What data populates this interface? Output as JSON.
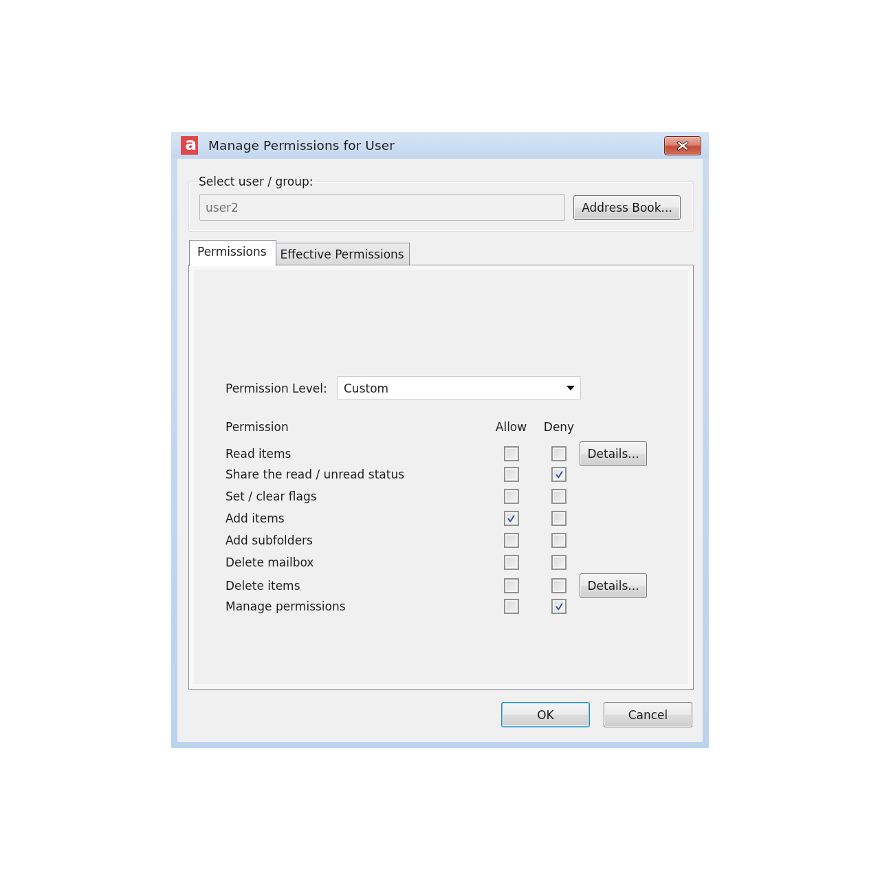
{
  "window": {
    "logo_text": "a",
    "title": "Manage Permissions for User"
  },
  "user_group": {
    "legend": "Select user / group:",
    "value": "user2",
    "disabled": true,
    "button": "Address Book..."
  },
  "tabs": [
    {
      "label": "Permissions",
      "selected": true
    },
    {
      "label": "Effective Permissions",
      "selected": false
    }
  ],
  "permission_level": {
    "label": "Permission Level:",
    "value": "Custom"
  },
  "permissions": {
    "columns": [
      "Permission",
      "Allow",
      "Deny"
    ],
    "rows": [
      {
        "name": "Read items",
        "allow": false,
        "deny": false,
        "details": "Details..."
      },
      {
        "name": "Share the read / unread status",
        "allow": false,
        "deny": true
      },
      {
        "name": "Set / clear flags",
        "allow": false,
        "deny": false
      },
      {
        "name": "Add items",
        "allow": true,
        "deny": false
      },
      {
        "name": "Add subfolders",
        "allow": false,
        "deny": false
      },
      {
        "name": "Delete mailbox",
        "allow": false,
        "deny": false
      },
      {
        "name": "Delete items",
        "allow": false,
        "deny": false,
        "details": "Details..."
      },
      {
        "name": "Manage permissions",
        "allow": false,
        "deny": true
      }
    ]
  },
  "buttons": [
    {
      "label": "OK",
      "default": true
    },
    {
      "label": "Cancel",
      "default": false
    }
  ]
}
